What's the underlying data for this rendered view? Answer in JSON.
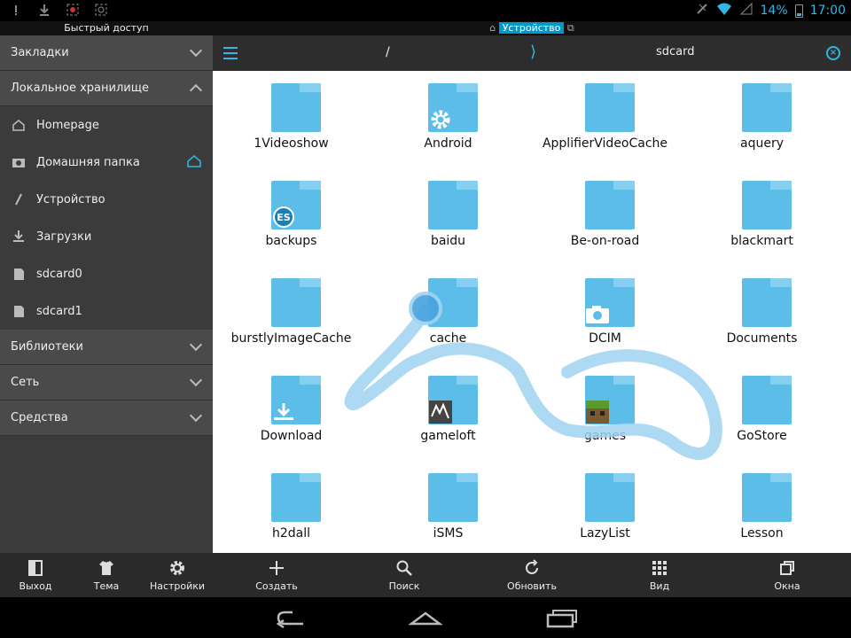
{
  "status_bar": {
    "battery": "14%",
    "time": "17:00"
  },
  "sidebar": {
    "title": "Быстрый доступ",
    "sections": {
      "bookmarks": "Закладки",
      "local": "Локальное хранилище",
      "libraries": "Библиотеки",
      "network": "Сеть",
      "tools": "Средства"
    },
    "local_items": [
      "Homepage",
      "Домашняя папка",
      "Устройство",
      "Загрузки",
      "sdcard0",
      "sdcard1"
    ]
  },
  "main": {
    "title_device": "Устройство",
    "path_root": "/",
    "path_current": "sdcard",
    "folders": [
      "1Videoshow",
      "Android",
      "ApplifierVideoCache",
      "aquery",
      "backups",
      "baidu",
      "Be-on-road",
      "blackmart",
      "burstlyImageCache",
      "cache",
      "DCIM",
      "Documents",
      "Download",
      "gameloft",
      "games",
      "GoStore",
      "h2dall",
      "iSMS",
      "LazyList",
      "Lesson"
    ]
  },
  "toolbar_left": [
    "Выход",
    "Тема",
    "Настройки"
  ],
  "toolbar_right": [
    "Создать",
    "Поиск",
    "Обновить",
    "Вид",
    "Окна"
  ],
  "colors": {
    "accent": "#33b5e5",
    "folder": "#5cbee8",
    "sidebar": "#3b3b3b"
  }
}
